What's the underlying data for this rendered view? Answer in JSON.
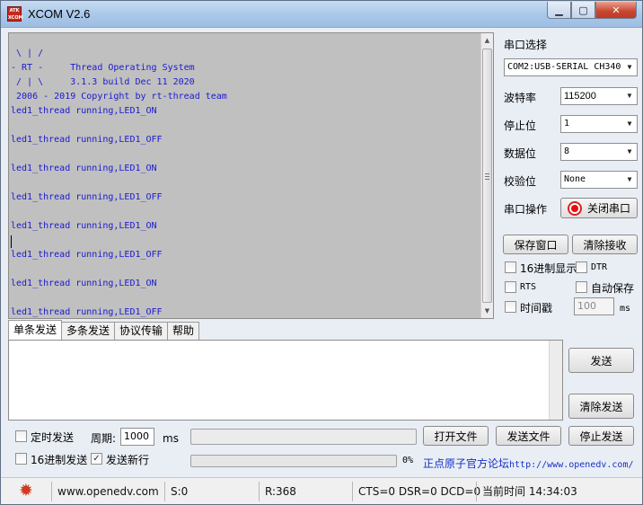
{
  "window": {
    "title": "XCOM V2.6",
    "logo_text": "ATK XCOM",
    "minimize": "▁",
    "maximize": "▢",
    "close": "✕"
  },
  "receive": {
    "lines": [
      " \\ | /",
      "- RT -     Thread Operating System",
      " / | \\     3.1.3 build Dec 11 2020",
      " 2006 - 2019 Copyright by rt-thread team",
      "led1_thread running,LED1_ON",
      "",
      "led1_thread running,LED1_OFF",
      "",
      "led1_thread running,LED1_ON",
      "",
      "led1_thread running,LED1_OFF",
      "",
      "led1_thread running,LED1_ON",
      "",
      "led1_thread running,LED1_OFF",
      "",
      "led1_thread running,LED1_ON",
      "",
      "led1_thread running,LED1_OFF"
    ]
  },
  "settings": {
    "port_label": "串口选择",
    "port_value": "COM2:USB-SERIAL CH340",
    "baud_label": "波特率",
    "baud_value": "115200",
    "stop_label": "停止位",
    "stop_value": "1",
    "data_label": "数据位",
    "data_value": "8",
    "parity_label": "校验位",
    "parity_value": "None",
    "op_label": "串口操作",
    "op_button": "关闭串口"
  },
  "actions": {
    "save_window": "保存窗口",
    "clear_receive": "清除接收"
  },
  "options": {
    "hex_display": {
      "label": "16进制显示",
      "checked": false
    },
    "dtr": {
      "label": "DTR",
      "checked": false
    },
    "rts": {
      "label": "RTS",
      "checked": false
    },
    "auto_save": {
      "label": "自动保存",
      "checked": false
    },
    "timestamp": {
      "label": "时间戳",
      "checked": false
    },
    "timestamp_ms_value": "100",
    "ms_unit": "ms"
  },
  "tabs": [
    "单条发送",
    "多条发送",
    "协议传输",
    "帮助"
  ],
  "send": {
    "text": "",
    "send_button": "发送",
    "clear_send_button": "清除发送"
  },
  "bottom": {
    "timed_send": {
      "label": "定时发送",
      "checked": false
    },
    "period_label": "周期:",
    "period_value": "1000",
    "period_unit": "ms",
    "open_file": "打开文件",
    "send_file": "发送文件",
    "stop_send": "停止发送",
    "hex_send": {
      "label": "16进制发送",
      "checked": false
    },
    "send_newline": {
      "label": "发送新行",
      "checked": true
    },
    "progress_percent": 0,
    "progress_text": "0%",
    "forum_link": "正点原子官方论坛",
    "forum_url": "http://www.openedv.com/"
  },
  "status": {
    "site": "www.openedv.com",
    "sent": "S:0",
    "received": "R:368",
    "lines": "CTS=0 DSR=0 DCD=0",
    "time": "当前时间 14:34:03"
  },
  "colors": {
    "recv_bg": "#c0c0c0",
    "recv_text": "#1a1ad0",
    "link": "#1530c8",
    "close_button": "#c23a25",
    "record_red": "#e01010"
  }
}
